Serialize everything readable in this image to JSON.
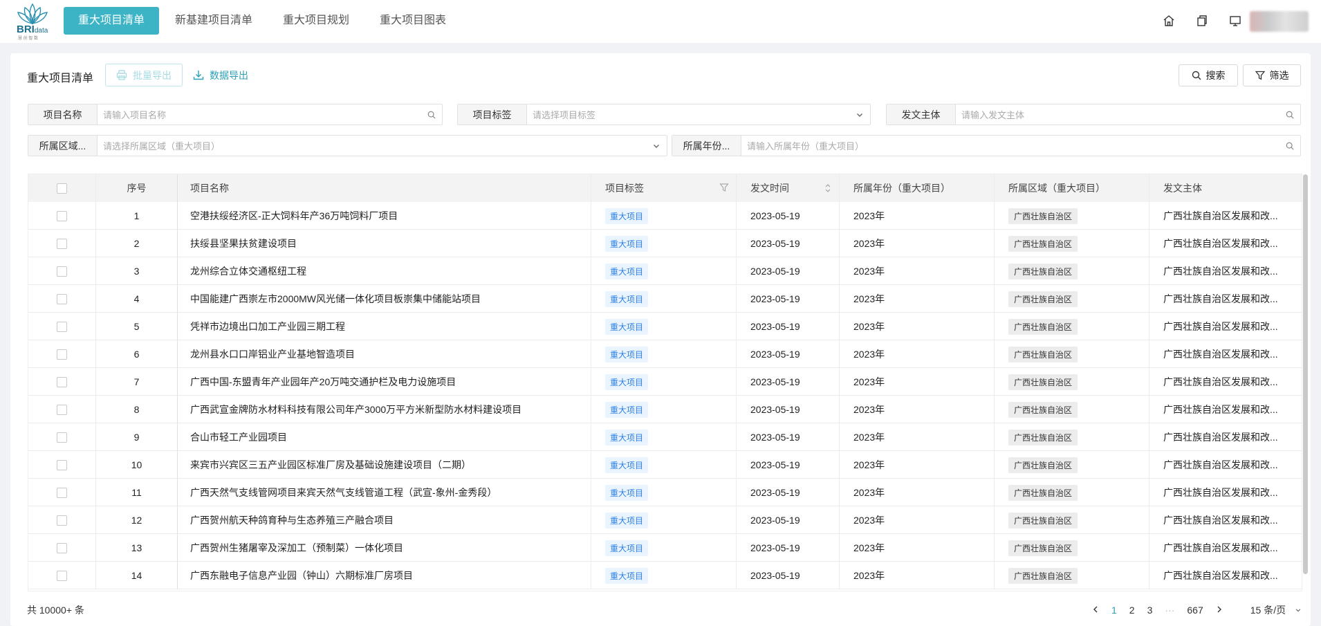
{
  "app": {
    "logo_text": "BRI",
    "logo_text_small": "data",
    "logo_subtext": "慧 创 智 数"
  },
  "nav": {
    "items": [
      {
        "label": "重大项目清单",
        "active": true
      },
      {
        "label": "新基建项目清单",
        "active": false
      },
      {
        "label": "重大项目规划",
        "active": false
      },
      {
        "label": "重大项目图表",
        "active": false
      }
    ]
  },
  "top_icons": [
    "home-icon",
    "copy-icon",
    "monitor-icon"
  ],
  "toolbar": {
    "title": "重大项目清单",
    "batch_export": "批量导出",
    "data_export": "数据导出",
    "search": "搜索",
    "filter": "筛选"
  },
  "filters": {
    "project_name": {
      "label": "项目名称",
      "placeholder": "请输入项目名称"
    },
    "project_tag": {
      "label": "项目标签",
      "placeholder": "请选择项目标签"
    },
    "publisher": {
      "label": "发文主体",
      "placeholder": "请输入发文主体"
    },
    "area": {
      "label": "所属区域...",
      "placeholder": "请选择所属区域（重大项目）"
    },
    "year": {
      "label": "所属年份...",
      "placeholder": "请输入所属年份（重大项目）"
    }
  },
  "table": {
    "headers": {
      "index": "序号",
      "name": "项目名称",
      "tag": "项目标签",
      "date": "发文时间",
      "year": "所属年份（重大项目）",
      "area": "所属区域（重大项目）",
      "publisher": "发文主体"
    },
    "rows": [
      {
        "index": "1",
        "name": "空港扶绥经济区-正大饲料年产36万吨饲料厂项目",
        "tag": "重大项目",
        "date": "2023-05-19",
        "year": "2023年",
        "area": "广西壮族自治区",
        "publisher": "广西壮族自治区发展和改..."
      },
      {
        "index": "2",
        "name": "扶绥县坚果扶贫建设项目",
        "tag": "重大项目",
        "date": "2023-05-19",
        "year": "2023年",
        "area": "广西壮族自治区",
        "publisher": "广西壮族自治区发展和改..."
      },
      {
        "index": "3",
        "name": "龙州综合立体交通枢纽工程",
        "tag": "重大项目",
        "date": "2023-05-19",
        "year": "2023年",
        "area": "广西壮族自治区",
        "publisher": "广西壮族自治区发展和改..."
      },
      {
        "index": "4",
        "name": "中国能建广西崇左市2000MW风光储一体化项目板崇集中储能站项目",
        "tag": "重大项目",
        "date": "2023-05-19",
        "year": "2023年",
        "area": "广西壮族自治区",
        "publisher": "广西壮族自治区发展和改..."
      },
      {
        "index": "5",
        "name": "凭祥市边境出口加工产业园三期工程",
        "tag": "重大项目",
        "date": "2023-05-19",
        "year": "2023年",
        "area": "广西壮族自治区",
        "publisher": "广西壮族自治区发展和改..."
      },
      {
        "index": "6",
        "name": "龙州县水口口岸铝业产业基地智造项目",
        "tag": "重大项目",
        "date": "2023-05-19",
        "year": "2023年",
        "area": "广西壮族自治区",
        "publisher": "广西壮族自治区发展和改..."
      },
      {
        "index": "7",
        "name": "广西中国-东盟青年产业园年产20万吨交通护栏及电力设施项目",
        "tag": "重大项目",
        "date": "2023-05-19",
        "year": "2023年",
        "area": "广西壮族自治区",
        "publisher": "广西壮族自治区发展和改..."
      },
      {
        "index": "8",
        "name": "广西武宣金牌防水材料科技有限公司年产3000万平方米新型防水材料建设项目",
        "tag": "重大项目",
        "date": "2023-05-19",
        "year": "2023年",
        "area": "广西壮族自治区",
        "publisher": "广西壮族自治区发展和改..."
      },
      {
        "index": "9",
        "name": "合山市轻工产业园项目",
        "tag": "重大项目",
        "date": "2023-05-19",
        "year": "2023年",
        "area": "广西壮族自治区",
        "publisher": "广西壮族自治区发展和改..."
      },
      {
        "index": "10",
        "name": "来宾市兴宾区三五产业园区标准厂房及基础设施建设项目（二期）",
        "tag": "重大项目",
        "date": "2023-05-19",
        "year": "2023年",
        "area": "广西壮族自治区",
        "publisher": "广西壮族自治区发展和改..."
      },
      {
        "index": "11",
        "name": "广西天然气支线管网项目来宾天然气支线管道工程（武宣-象州-金秀段）",
        "tag": "重大项目",
        "date": "2023-05-19",
        "year": "2023年",
        "area": "广西壮族自治区",
        "publisher": "广西壮族自治区发展和改..."
      },
      {
        "index": "12",
        "name": "广西贺州航天种鸽育种与生态养殖三产融合项目",
        "tag": "重大项目",
        "date": "2023-05-19",
        "year": "2023年",
        "area": "广西壮族自治区",
        "publisher": "广西壮族自治区发展和改..."
      },
      {
        "index": "13",
        "name": "广西贺州生猪屠宰及深加工（预制菜）一体化项目",
        "tag": "重大项目",
        "date": "2023-05-19",
        "year": "2023年",
        "area": "广西壮族自治区",
        "publisher": "广西壮族自治区发展和改..."
      },
      {
        "index": "14",
        "name": "广西东融电子信息产业园（钟山）六期标准厂房项目",
        "tag": "重大项目",
        "date": "2023-05-19",
        "year": "2023年",
        "area": "广西壮族自治区",
        "publisher": "广西壮族自治区发展和改..."
      }
    ]
  },
  "footer": {
    "total": "共 10000+ 条",
    "pages": [
      "1",
      "2",
      "3"
    ],
    "current_page": "1",
    "ellipsis": "···",
    "last_page": "667",
    "page_size": "15 条/页"
  },
  "colors": {
    "accent": "#3cb4c6",
    "link": "#2b9fb5",
    "tag_text": "#2f7fe0",
    "tag_bg": "#eaf4ff"
  }
}
